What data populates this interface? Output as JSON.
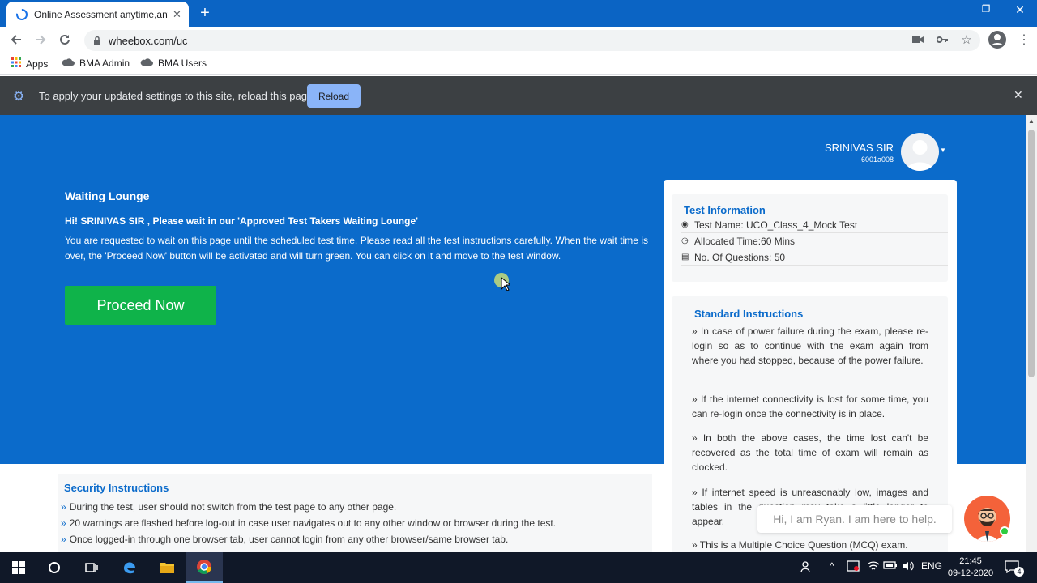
{
  "browser": {
    "tab_title": "Online Assessment anytime,anywhere",
    "new_tab": "+",
    "url": "wheebox.com/uc",
    "bookmarks": [
      {
        "label": "Apps",
        "icon": "apps-grid-icon"
      },
      {
        "label": "BMA Admin",
        "icon": "cloud-icon"
      },
      {
        "label": "BMA Users",
        "icon": "cloud-icon"
      }
    ],
    "infobar": {
      "message": "To apply your updated settings to this site, reload this page",
      "button": "Reload"
    }
  },
  "user": {
    "name": "SRINIVAS SIR",
    "id": "6001a008"
  },
  "lounge": {
    "title": "Waiting Lounge",
    "greeting": "Hi! SRINIVAS SIR , Please wait in our 'Approved Test Takers Waiting Lounge'",
    "description": "You are requested to wait on this page until the scheduled test time. Please read all the test instructions carefully. When the wait time is over, the 'Proceed Now' button will be activated and will turn green. You can click on it and move to the test window.",
    "proceed_button": "Proceed Now"
  },
  "test_info": {
    "title": "Test Information",
    "rows": [
      {
        "icon": "target-icon",
        "text": "Test Name: UCO_Class_4_Mock Test"
      },
      {
        "icon": "clock-icon",
        "text": "Allocated Time:60 Mins"
      },
      {
        "icon": "clipboard-icon",
        "text": "No. Of Questions: 50"
      }
    ]
  },
  "standard_instructions": {
    "title": "Standard Instructions",
    "items": [
      "» In case of power failure during the exam, please re-login so as to continue with the exam again from where you had stopped, because of the power failure.",
      "» If the internet connectivity is lost for some time, you can re-login once the connectivity is in place.",
      "» In both the above cases, the time lost can't be recovered as the total time of exam will remain as clocked.",
      "» If internet speed is unreasonably low, images and tables in the question may take a little longer to appear.",
      "» This is a Multiple Choice Question (MCQ) exam."
    ]
  },
  "security_instructions": {
    "title": "Security Instructions",
    "bullet": "»",
    "items": [
      "During the test, user should not switch from the test page to any other page.",
      "20 warnings are flashed before log-out in case user navigates out to any other window or browser during the test.",
      "Once logged-in through one browser tab, user cannot login from any other browser/same browser tab."
    ]
  },
  "chat": {
    "message": "Hi, I am Ryan. I am here to help."
  },
  "taskbar": {
    "language": "ENG",
    "time": "21:45",
    "date": "09-12-2020",
    "notifications": "4"
  },
  "colors": {
    "brand_blue": "#0b6bcb",
    "proceed_green": "#0fb34a",
    "chrome_blue": "#0b64c4"
  }
}
